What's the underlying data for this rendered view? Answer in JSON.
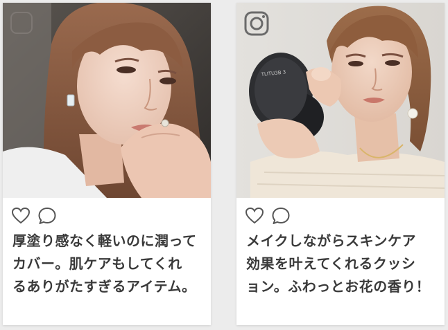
{
  "cards": [
    {
      "image_alt": "Portrait of a woman with long light-brown hair and bangs resting her chin on her hand",
      "caption": "厚塗り感なく軽いのに潤って\nカバー。肌ケアもしてくれ\nるありがたすぎるアイテム。"
    },
    {
      "image_alt": "Woman applying makeup with a sponge while holding a black cushion compact",
      "compact_text": "TLITU3B 3",
      "caption": "メイクしながらスキンケア\n効果を叶えてくれるクッシ\nョン。ふわっとお花の香り！"
    }
  ],
  "colors": {
    "caption_text": "#3a3a3a",
    "icon_stroke": "#555555",
    "card_bg": "#ffffff",
    "page_bg": "#ececec"
  },
  "icons": {
    "like": "heart-outline-icon",
    "comment": "speech-bubble-icon",
    "instagram": "instagram-icon"
  }
}
